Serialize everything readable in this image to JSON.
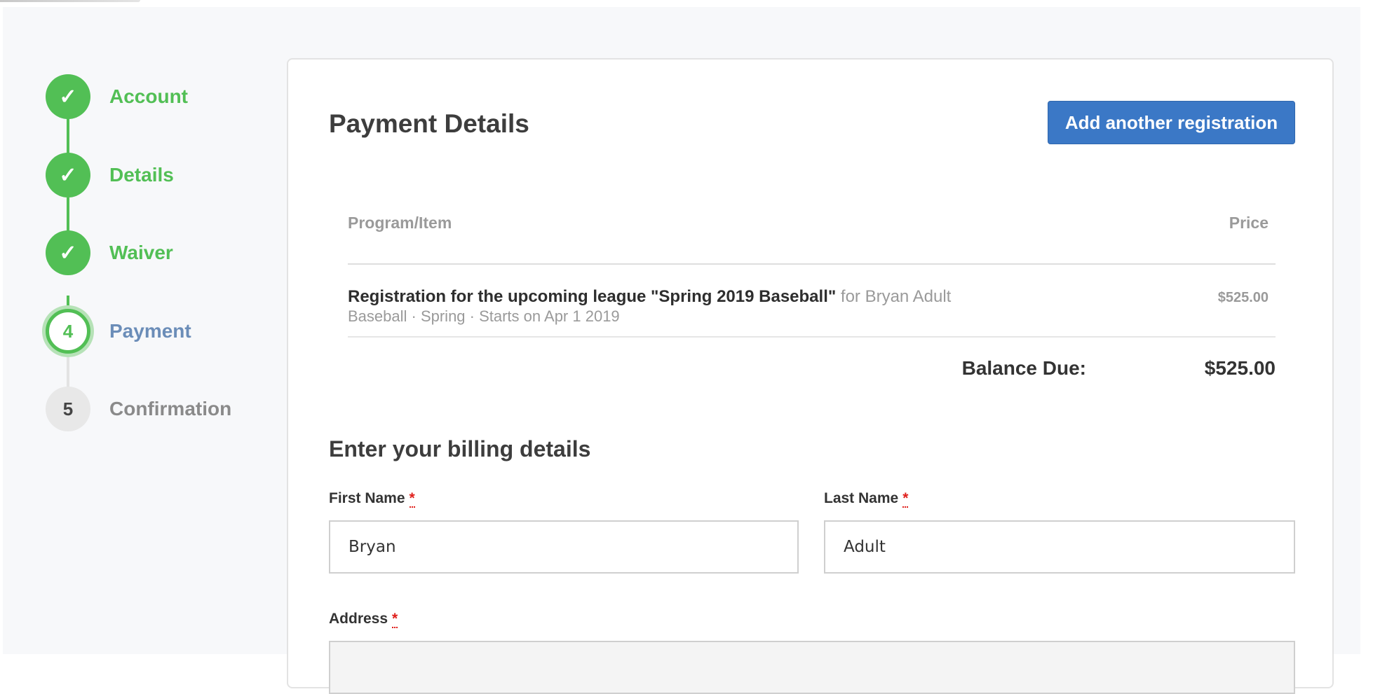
{
  "stepper": {
    "steps": [
      {
        "number": "1",
        "label": "Account",
        "state": "done",
        "icon": "check-icon"
      },
      {
        "number": "2",
        "label": "Details",
        "state": "done",
        "icon": "check-icon"
      },
      {
        "number": "3",
        "label": "Waiver",
        "state": "done",
        "icon": "check-icon"
      },
      {
        "number": "4",
        "label": "Payment",
        "state": "current"
      },
      {
        "number": "5",
        "label": "Confirmation",
        "state": "todo"
      }
    ],
    "check_glyph": "✓"
  },
  "payment": {
    "title": "Payment Details",
    "add_button_label": "Add another registration",
    "table": {
      "headers": {
        "item": "Program/Item",
        "price": "Price"
      },
      "rows": [
        {
          "name": "Registration for the upcoming league \"Spring 2019 Baseball\"",
          "for_text": "for Bryan Adult",
          "details": "Baseball · Spring · Starts on Apr 1 2019",
          "price": "$525.00"
        }
      ]
    },
    "balance": {
      "label": "Balance Due:",
      "value": "$525.00"
    }
  },
  "billing": {
    "title": "Enter your billing details",
    "required_marker": "*",
    "first_name": {
      "label": "First Name",
      "value": "Bryan"
    },
    "last_name": {
      "label": "Last Name",
      "value": "Adult"
    },
    "address": {
      "label": "Address",
      "value": ""
    }
  },
  "colors": {
    "done": "#52bf55",
    "current_label": "#6b8db8",
    "button": "#3b78c6",
    "required": "#e0201c"
  }
}
